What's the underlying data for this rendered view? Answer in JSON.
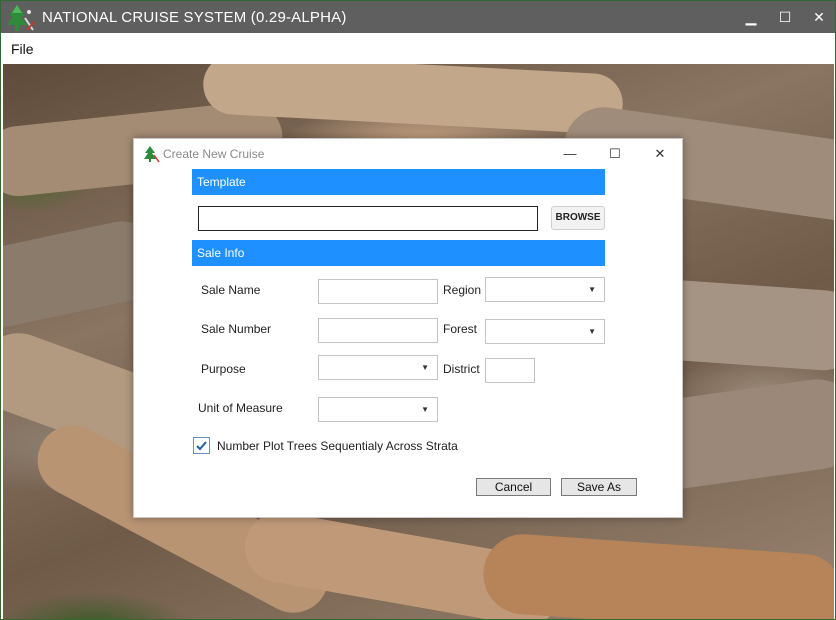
{
  "app": {
    "title": "NATIONAL CRUISE SYSTEM (0.29-ALPHA)",
    "window_controls": {
      "minimize": "▁",
      "maximize": "☐",
      "close": "✕"
    },
    "menu": {
      "file": "File"
    }
  },
  "dialog": {
    "title": "Create New Cruise",
    "controls": {
      "minimize": "—",
      "maximize": "☐",
      "close": "✕"
    },
    "template_section": "Template",
    "template_path": "",
    "browse_label": "BROWSE",
    "sale_section": "Sale Info",
    "fields": {
      "sale_name_label": "Sale Name",
      "sale_name_value": "",
      "region_label": "Region",
      "region_value": "",
      "sale_number_label": "Sale Number",
      "sale_number_value": "",
      "forest_label": "Forest",
      "forest_value": "",
      "purpose_label": "Purpose",
      "purpose_value": "",
      "district_label": "District",
      "district_value": "",
      "uom_label": "Unit of Measure",
      "uom_value": ""
    },
    "sequential_checkbox": {
      "label": "Number Plot Trees Sequentialy Across Strata",
      "checked": true
    },
    "buttons": {
      "cancel": "Cancel",
      "save_as": "Save As"
    }
  },
  "colors": {
    "section_header": "#1e90ff",
    "titlebar": "#5f5f5f",
    "window_border": "#2f6b2f"
  }
}
